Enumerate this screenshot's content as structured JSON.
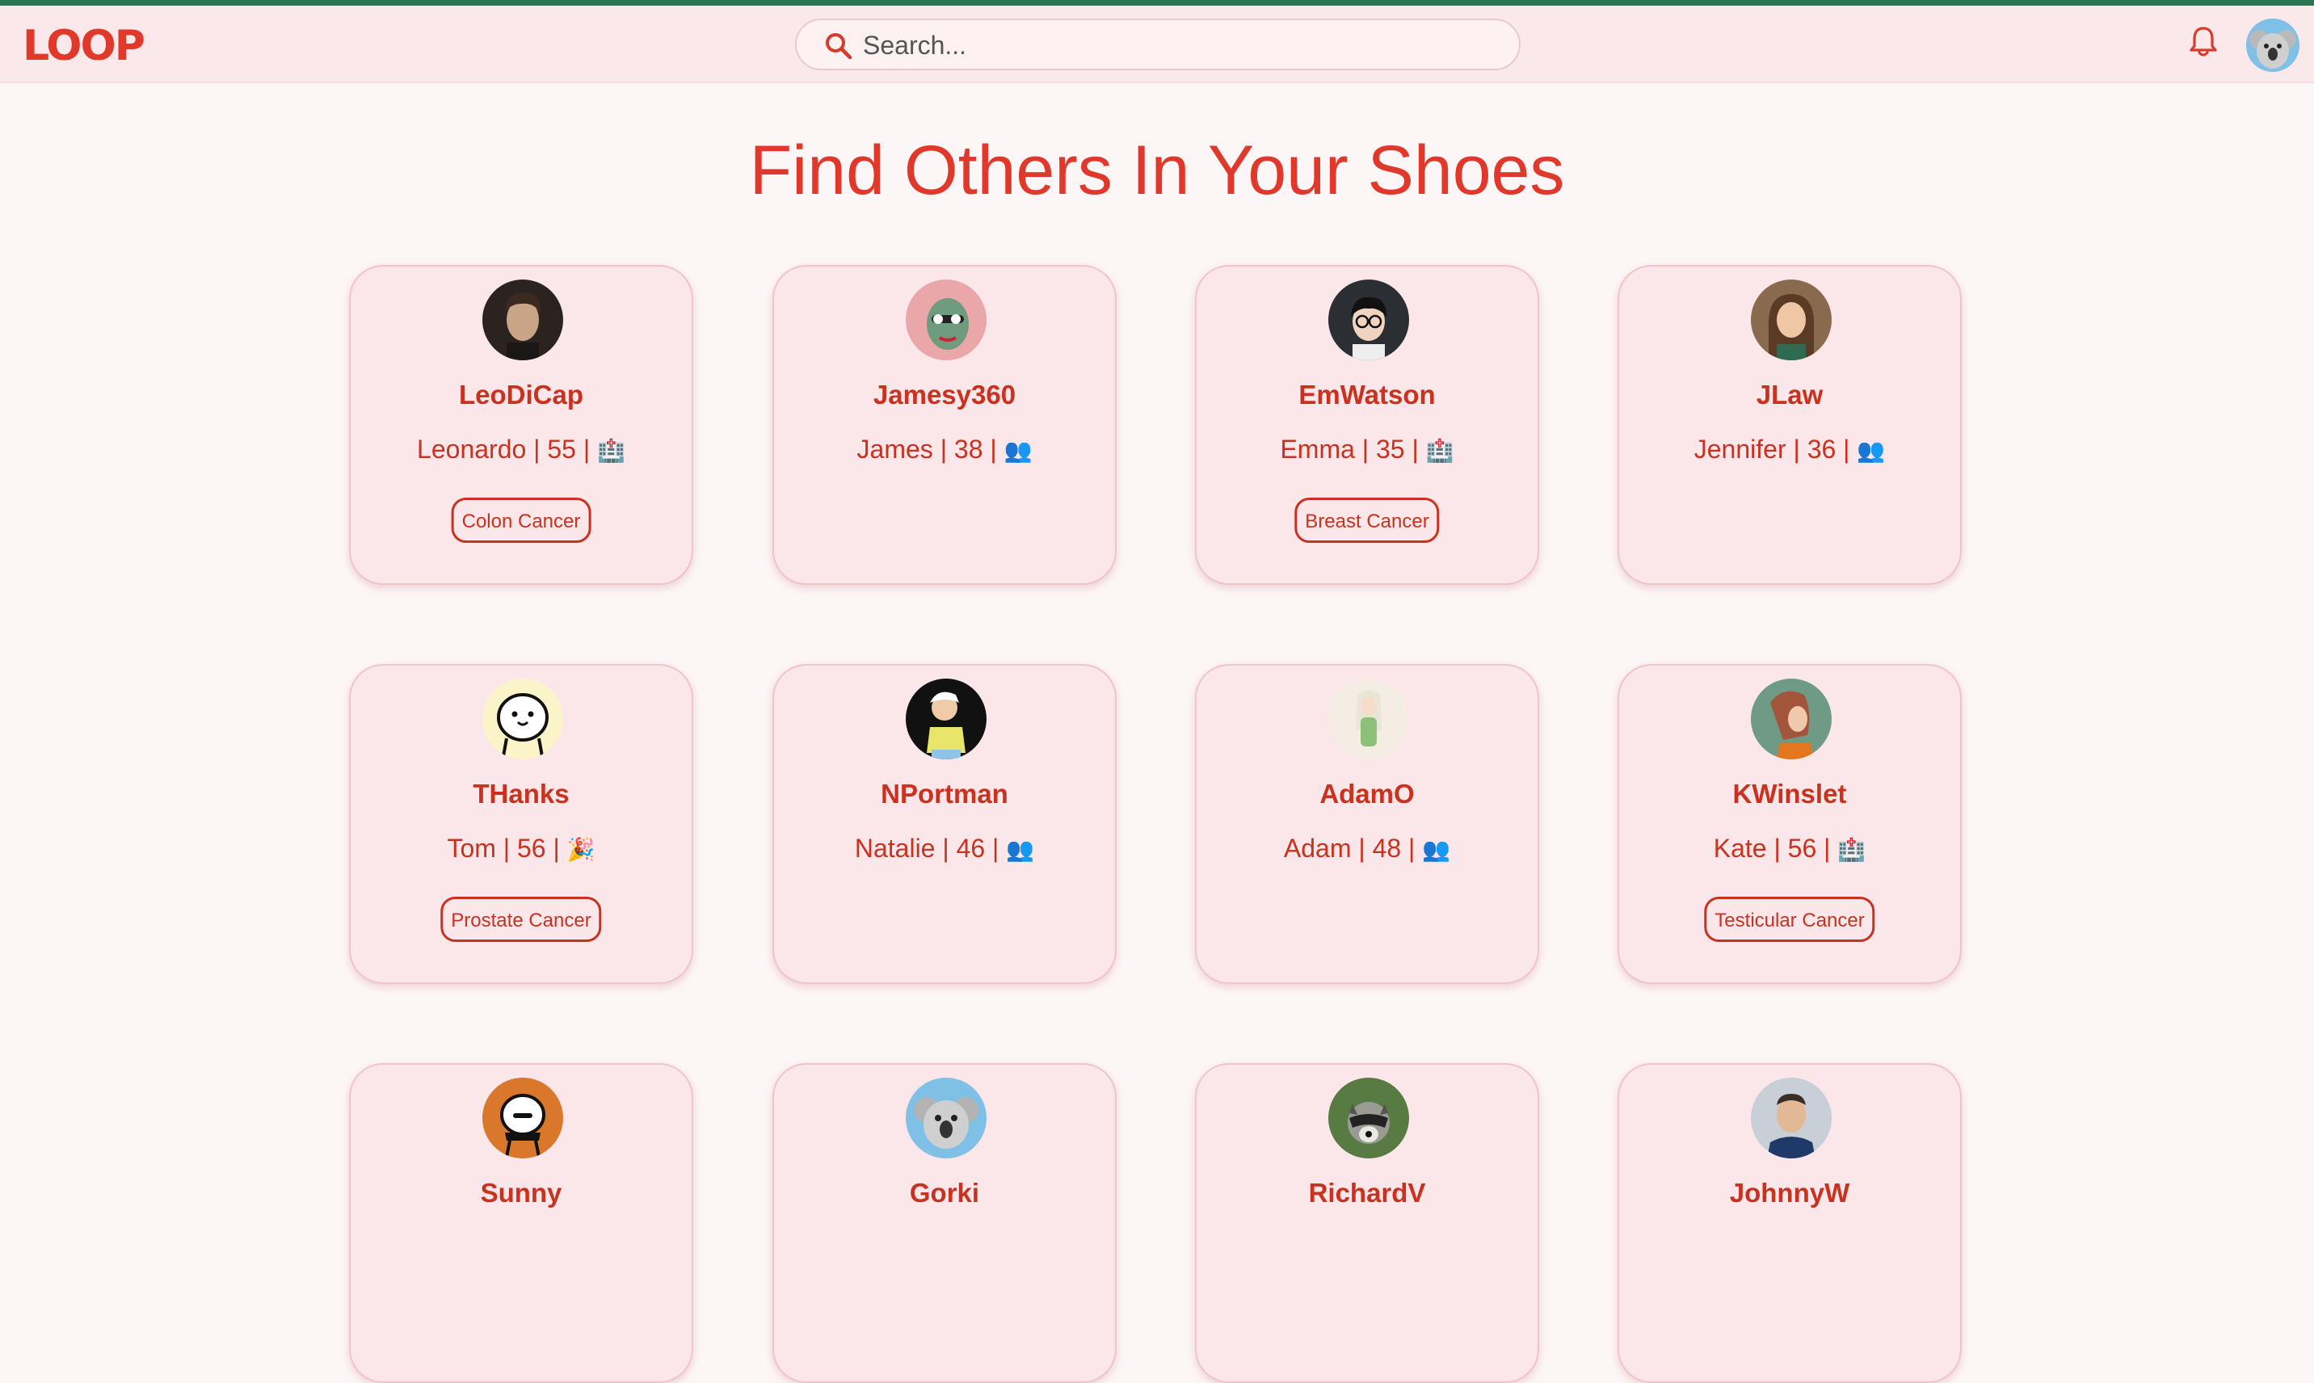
{
  "app": {
    "logo": "LOOP"
  },
  "search": {
    "placeholder": "Search..."
  },
  "page": {
    "title": "Find Others In Your Shoes"
  },
  "colors": {
    "accent": "#e0392b",
    "card_bg": "#fbe6e9",
    "header_bg": "#fbe8ea",
    "top_bar": "#2e7352"
  },
  "cards": [
    {
      "username": "LeoDiCap",
      "name": "Leonardo",
      "age": "55",
      "icon": "🏥",
      "tag": "Colon Cancer",
      "avatar": "man-dark-hair"
    },
    {
      "username": "Jamesy360",
      "name": "James",
      "age": "38",
      "icon": "👥",
      "tag": "",
      "avatar": "pink-cartoon"
    },
    {
      "username": "EmWatson",
      "name": "Emma",
      "age": "35",
      "icon": "🏥",
      "tag": "Breast Cancer",
      "avatar": "glasses-cartoon"
    },
    {
      "username": "JLaw",
      "name": "Jennifer",
      "age": "36",
      "icon": "👥",
      "tag": "",
      "avatar": "woman-illustration"
    },
    {
      "username": "THanks",
      "name": "Tom",
      "age": "56",
      "icon": "🎉",
      "tag": "Prostate Cancer",
      "avatar": "doodle-smile"
    },
    {
      "username": "NPortman",
      "name": "Natalie",
      "age": "46",
      "icon": "👥",
      "tag": "",
      "avatar": "girl-yellow"
    },
    {
      "username": "AdamO",
      "name": "Adam",
      "age": "48",
      "icon": "👥",
      "tag": "",
      "avatar": "fairy-green"
    },
    {
      "username": "KWinslet",
      "name": "Kate",
      "age": "56",
      "icon": "🏥",
      "tag": "Testicular Cancer",
      "avatar": "woman-profile"
    },
    {
      "username": "Sunny",
      "name": "",
      "age": "",
      "icon": "",
      "tag": "",
      "avatar": "doodle-orange"
    },
    {
      "username": "Gorki",
      "name": "",
      "age": "",
      "icon": "",
      "tag": "",
      "avatar": "koala"
    },
    {
      "username": "RichardV",
      "name": "",
      "age": "",
      "icon": "",
      "tag": "",
      "avatar": "raccoon"
    },
    {
      "username": "JohnnyW",
      "name": "",
      "age": "",
      "icon": "",
      "tag": "",
      "avatar": "man-photo"
    }
  ]
}
